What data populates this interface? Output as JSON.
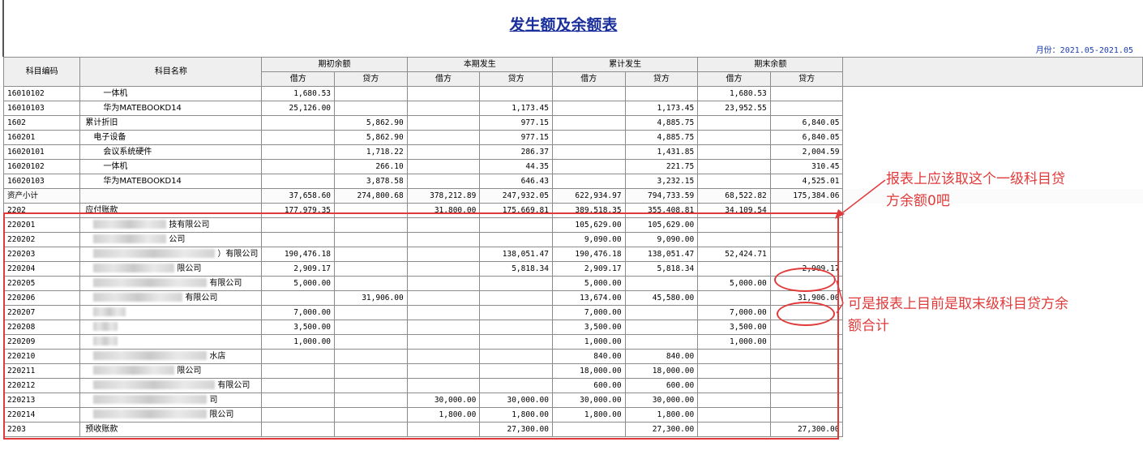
{
  "report": {
    "title": "发生额及余额表",
    "period": "月份：2021.05-2021.05"
  },
  "columns": {
    "code": "科目编码",
    "name": "科目名称",
    "groups": [
      "期初余额",
      "本期发生",
      "累计发生",
      "期末余额"
    ],
    "debit": "借方",
    "credit": "贷方"
  },
  "rows": [
    {
      "code": "16010102",
      "name": "一体机",
      "level": 3,
      "v": [
        "1,680.53",
        "",
        "",
        "",
        "",
        "",
        "1,680.53",
        ""
      ]
    },
    {
      "code": "16010103",
      "name": "华为MATEBOOKD14",
      "level": 3,
      "v": [
        "25,126.00",
        "",
        "",
        "1,173.45",
        "",
        "1,173.45",
        "23,952.55",
        ""
      ]
    },
    {
      "code": "1602",
      "name": "累计折旧",
      "level": 1,
      "v": [
        "",
        "5,862.90",
        "",
        "977.15",
        "",
        "4,885.75",
        "",
        "6,840.05"
      ]
    },
    {
      "code": "160201",
      "name": "电子设备",
      "level": 2,
      "v": [
        "",
        "5,862.90",
        "",
        "977.15",
        "",
        "4,885.75",
        "",
        "6,840.05"
      ]
    },
    {
      "code": "16020101",
      "name": "会议系统硬件",
      "level": 3,
      "v": [
        "",
        "1,718.22",
        "",
        "286.37",
        "",
        "1,431.85",
        "",
        "2,004.59"
      ]
    },
    {
      "code": "16020102",
      "name": "一体机",
      "level": 3,
      "v": [
        "",
        "266.10",
        "",
        "44.35",
        "",
        "221.75",
        "",
        "310.45"
      ]
    },
    {
      "code": "16020103",
      "name": "华为MATEBOOKD14",
      "level": 3,
      "v": [
        "",
        "3,878.58",
        "",
        "646.43",
        "",
        "3,232.15",
        "",
        "4,525.01"
      ]
    },
    {
      "code": "资产小计",
      "name": "",
      "level": 1,
      "subtotal": true,
      "v": [
        "37,658.60",
        "274,800.68",
        "378,212.89",
        "247,932.05",
        "622,934.97",
        "794,733.59",
        "68,522.82",
        "175,384.06"
      ]
    },
    {
      "code": "2202",
      "name": "应付账款",
      "level": 1,
      "v": [
        "177,979.35",
        "",
        "31,800.00",
        "175,669.81",
        "389,518.35",
        "355,408.81",
        "34,109.54",
        ""
      ]
    },
    {
      "code": "220201",
      "name": "技有限公司",
      "level": 2,
      "blur": 90,
      "v": [
        "",
        "",
        "",
        "",
        "105,629.00",
        "105,629.00",
        "",
        ""
      ]
    },
    {
      "code": "220202",
      "name": "公司",
      "level": 2,
      "blur": 90,
      "v": [
        "",
        "",
        "",
        "",
        "9,090.00",
        "9,090.00",
        "",
        ""
      ]
    },
    {
      "code": "220203",
      "name": "）有限公司",
      "level": 2,
      "blur": 150,
      "v": [
        "190,476.18",
        "",
        "",
        "138,051.47",
        "190,476.18",
        "138,051.47",
        "52,424.71",
        ""
      ]
    },
    {
      "code": "220204",
      "name": "限公司",
      "level": 2,
      "blur": 100,
      "v": [
        "2,909.17",
        "",
        "",
        "5,818.34",
        "2,909.17",
        "5,818.34",
        "",
        "2,909.17"
      ]
    },
    {
      "code": "220205",
      "name": "有限公司",
      "level": 2,
      "blur": 140,
      "v": [
        "5,000.00",
        "",
        "",
        "",
        "5,000.00",
        "",
        "5,000.00",
        ""
      ]
    },
    {
      "code": "220206",
      "name": "有限公司",
      "level": 2,
      "blur": 110,
      "v": [
        "",
        "31,906.00",
        "",
        "",
        "13,674.00",
        "45,580.00",
        "",
        "31,906.00"
      ]
    },
    {
      "code": "220207",
      "name": "",
      "level": 2,
      "blur": 40,
      "v": [
        "7,000.00",
        "",
        "",
        "",
        "7,000.00",
        "",
        "7,000.00",
        ""
      ]
    },
    {
      "code": "220208",
      "name": "",
      "level": 2,
      "blur": 30,
      "v": [
        "3,500.00",
        "",
        "",
        "",
        "3,500.00",
        "",
        "3,500.00",
        ""
      ]
    },
    {
      "code": "220209",
      "name": "",
      "level": 2,
      "blur": 30,
      "v": [
        "1,000.00",
        "",
        "",
        "",
        "1,000.00",
        "",
        "1,000.00",
        ""
      ]
    },
    {
      "code": "220210",
      "name": "水店",
      "level": 2,
      "blur": 140,
      "v": [
        "",
        "",
        "",
        "",
        "840.00",
        "840.00",
        "",
        ""
      ]
    },
    {
      "code": "220211",
      "name": "限公司",
      "level": 2,
      "blur": 100,
      "v": [
        "",
        "",
        "",
        "",
        "18,000.00",
        "18,000.00",
        "",
        ""
      ]
    },
    {
      "code": "220212",
      "name": "有限公司",
      "level": 2,
      "blur": 150,
      "v": [
        "",
        "",
        "",
        "",
        "600.00",
        "600.00",
        "",
        ""
      ]
    },
    {
      "code": "220213",
      "name": "司",
      "level": 2,
      "blur": 140,
      "v": [
        "",
        "",
        "30,000.00",
        "30,000.00",
        "30,000.00",
        "30,000.00",
        "",
        ""
      ]
    },
    {
      "code": "220214",
      "name": "限公司",
      "level": 2,
      "blur": 140,
      "v": [
        "",
        "",
        "1,800.00",
        "1,800.00",
        "1,800.00",
        "1,800.00",
        "",
        ""
      ]
    },
    {
      "code": "2203",
      "name": "预收账款",
      "level": 1,
      "v": [
        "",
        "",
        "",
        "27,300.00",
        "",
        "27,300.00",
        "",
        "27,300.00"
      ]
    }
  ],
  "annotations": {
    "note1": [
      "报表上应该取这个一级科目贷",
      "方余额0吧"
    ],
    "note2": [
      "可是报表上目前是取末级科目贷方余",
      "额合计"
    ],
    "color": "#e03a3a"
  }
}
